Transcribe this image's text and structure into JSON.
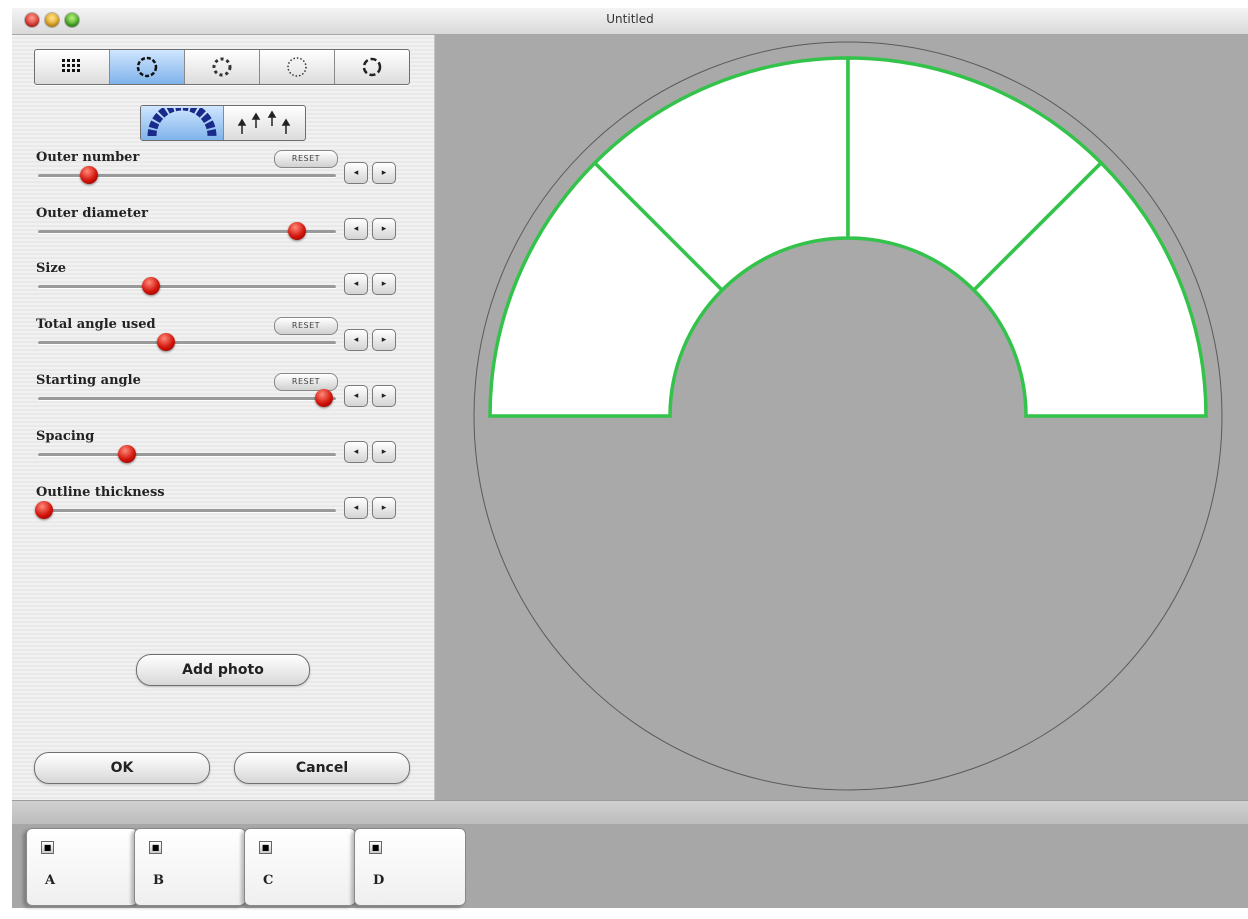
{
  "window": {
    "title": "Untitled"
  },
  "layout_modes": {
    "items": [
      {
        "icon": "grid-layout-icon",
        "active": false
      },
      {
        "icon": "circle-layout-icon",
        "active": true
      },
      {
        "icon": "ring-layout-icon",
        "active": false
      },
      {
        "icon": "dotted-ring-layout-icon",
        "active": false
      },
      {
        "icon": "open-ring-layout-icon",
        "active": false
      }
    ]
  },
  "orientation": {
    "items": [
      {
        "icon": "radial-arc-icon",
        "active": true
      },
      {
        "icon": "upright-arrows-icon",
        "active": false
      }
    ]
  },
  "controls": [
    {
      "id": "outer-number",
      "label": "Outer number",
      "reset": "RESET",
      "value": 0.17
    },
    {
      "id": "outer-diameter",
      "label": "Outer diameter",
      "reset": "",
      "value": 0.87
    },
    {
      "id": "size",
      "label": "Size",
      "reset": "",
      "value": 0.38
    },
    {
      "id": "total-angle-used",
      "label": "Total angle used",
      "reset": "RESET",
      "value": 0.43
    },
    {
      "id": "starting-angle",
      "label": "Starting angle",
      "reset": "RESET",
      "value": 0.96
    },
    {
      "id": "spacing",
      "label": "Spacing",
      "reset": "",
      "value": 0.3
    },
    {
      "id": "outline-thickness",
      "label": "Outline thickness",
      "reset": "",
      "value": 0.02
    }
  ],
  "arrows": {
    "left": "◂",
    "right": "▸"
  },
  "buttons": {
    "add_photo": "Add photo",
    "ok": "OK",
    "cancel": "Cancel"
  },
  "preview": {
    "segments": 4,
    "outline_color": "#34c34a",
    "segment_fill": "#ffffff",
    "background": "#a9a9a9"
  },
  "tray": {
    "tiles": [
      {
        "label": "A",
        "checked": true
      },
      {
        "label": "B",
        "checked": true
      },
      {
        "label": "C",
        "checked": true
      },
      {
        "label": "D",
        "checked": true
      }
    ]
  }
}
